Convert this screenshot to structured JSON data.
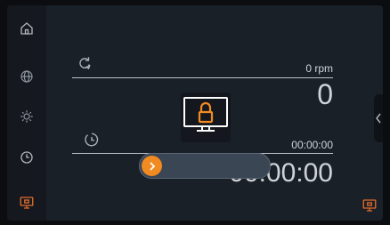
{
  "sidebar": {
    "items": [
      {
        "icon": "home-icon"
      },
      {
        "icon": "globe-icon"
      },
      {
        "icon": "brightness-icon"
      },
      {
        "icon": "timer-icon"
      },
      {
        "icon": "monitor-icon"
      }
    ]
  },
  "speed": {
    "icon": "rotation-speed-icon",
    "unit_label": "0 rpm",
    "value": "0"
  },
  "time": {
    "icon": "clock-icon",
    "set_label": "00:00:00",
    "value": "00:00:00"
  },
  "lock_overlay": {
    "icon": "screen-lock-icon"
  },
  "unlock_slider": {
    "knob_icon": "chevron-right-icon",
    "accent_color": "#f28a22",
    "level": 0
  },
  "side_tab": {
    "icon": "chevron-left-icon"
  },
  "bottom_button": {
    "icon": "monitor-icon"
  }
}
